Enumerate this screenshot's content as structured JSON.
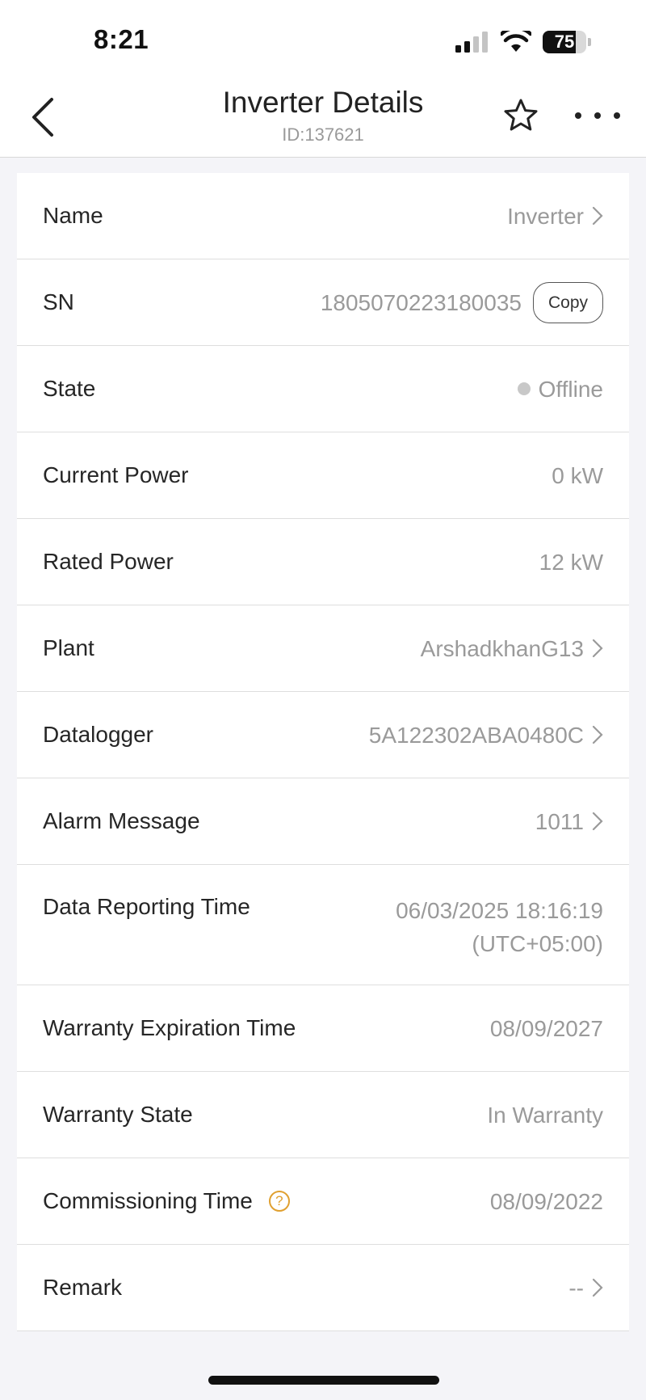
{
  "status_bar": {
    "time": "8:21",
    "battery": "75",
    "battery_level": 0.75
  },
  "nav": {
    "title": "Inverter Details",
    "subtitle": "ID:137621"
  },
  "colors": {
    "offline_dot": "#c8c8c8",
    "help_icon": "#e0a030"
  },
  "rows": [
    {
      "label": "Name",
      "value": "Inverter"
    },
    {
      "label": "SN",
      "value": "1805070223180035",
      "action": "Copy"
    },
    {
      "label": "State",
      "value": "Offline"
    },
    {
      "label": "Current Power",
      "value": "0 kW"
    },
    {
      "label": "Rated Power",
      "value": "12 kW"
    },
    {
      "label": "Plant",
      "value": "ArshadkhanG13"
    },
    {
      "label": "Datalogger",
      "value": "5A122302ABA0480C"
    },
    {
      "label": "Alarm Message",
      "value": "1011"
    },
    {
      "label": "Data Reporting Time",
      "value": "06/03/2025 18:16:19",
      "value2": "(UTC+05:00)"
    },
    {
      "label": "Warranty Expiration Time",
      "value": "08/09/2027"
    },
    {
      "label": "Warranty State",
      "value": "In Warranty"
    },
    {
      "label": "Commissioning Time",
      "value": "08/09/2022",
      "help_icon": "?"
    },
    {
      "label": "Remark",
      "value": "--"
    }
  ]
}
